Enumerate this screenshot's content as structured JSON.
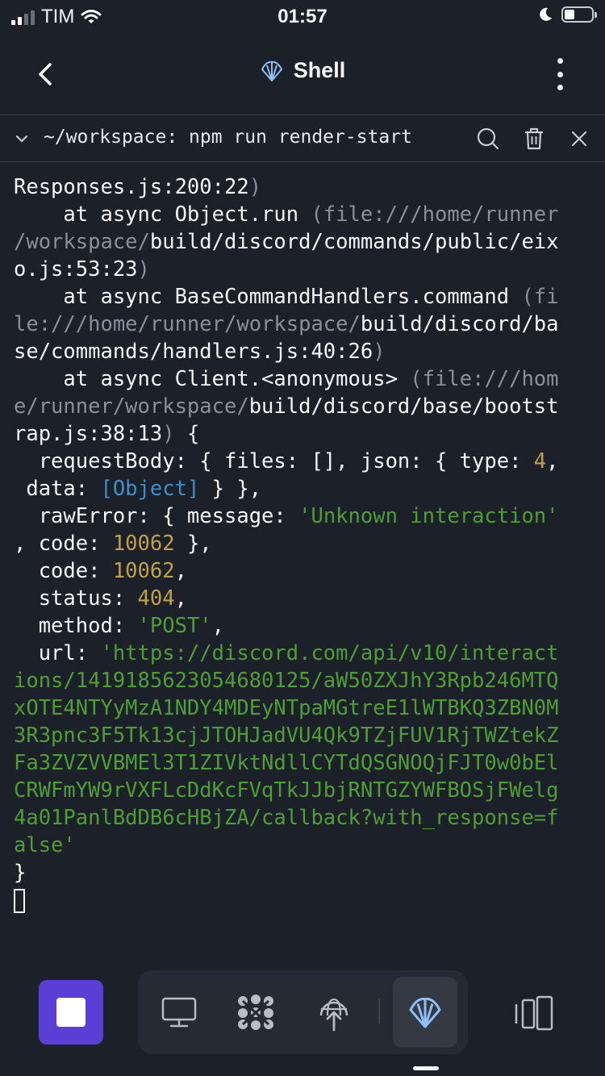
{
  "status_bar": {
    "carrier": "TIM",
    "time": "01:57"
  },
  "header": {
    "title": "Shell"
  },
  "command_bar": {
    "command": "~/workspace: npm run render-start"
  },
  "terminal": {
    "l01a": "Responses.js:200:22",
    "l01b": ")",
    "l02a": "    at async Object.run ",
    "l02b": "(file:///home/runner",
    "l03a": "/workspace/",
    "l03b": "build/discord/commands/public/eix",
    "l04a": "o.js:53:23",
    "l04b": ")",
    "l05a": "    at async BaseCommandHandlers.command ",
    "l05b": "(fi",
    "l06a": "le:///home/runner/workspace/",
    "l06b": "build/discord/ba",
    "l07a": "se/commands/handlers.js:40:26",
    "l07b": ")",
    "l08a": "    at async Client.<anonymous> ",
    "l08b": "(file:///hom",
    "l09a": "e/runner/workspace/",
    "l09b": "build/discord/base/bootst",
    "l10a": "rap.js:38:13",
    "l10b": ")",
    "l10c": " {",
    "l11a": "  requestBody: { files: [], json: { type: ",
    "l11b": "4",
    "l11c": ",",
    "l12a": " data: ",
    "l12b": "[Object]",
    "l12c": " } },",
    "l13a": "  rawError: { message: ",
    "l13b": "'Unknown interaction'",
    "l14a": ", code: ",
    "l14b": "10062",
    "l14c": " },",
    "l15a": "  code: ",
    "l15b": "10062",
    "l15c": ",",
    "l16a": "  status: ",
    "l16b": "404",
    "l16c": ",",
    "l17a": "  method: ",
    "l17b": "'POST'",
    "l17c": ",",
    "l18a": "  url: ",
    "l18b": "'https://discord.com/api/v10/interact",
    "l19": "ions/1419185623054680125/aW50ZXJhY3Rpb246MTQ",
    "l20": "xOTE4NTYyMzA1NDY4MDEyNTpaMGtreE1lWTBKQ3ZBN0M",
    "l21": "3R3pnc3F5Tk13cjJTOHJadVU4Qk9TZjFUV1RjTWZtekZ",
    "l22": "Fa3ZVZVVBMEl3T1ZIVktNdllCYTdQSGNOQjFJT0w0bEl",
    "l23": "CRWFmYW9rVXFLcDdKcFVqTkJJbjRNTGZYWFBOSjFWelg",
    "l24": "4a01PanlBdDB6cHBjZA/callback?with_response=f",
    "l25": "alse'",
    "l26": "}"
  },
  "dock": {
    "active_tab": "shell"
  },
  "colors": {
    "accent": "#5a3fd6",
    "string": "#4f9e35",
    "number": "#bfa14c",
    "special": "#3f8ec9",
    "dim": "#8a8f9b"
  }
}
